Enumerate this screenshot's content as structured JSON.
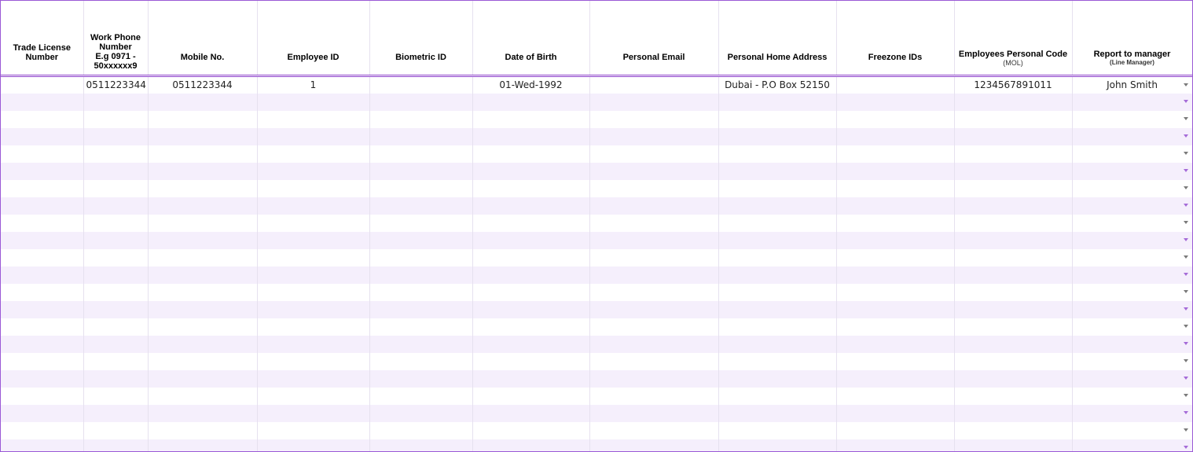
{
  "headers": {
    "trade_license": "Trade License Number",
    "work_phone_line1": "Work Phone Number",
    "work_phone_line2": "E.g 0971 - 50xxxxxx9",
    "mobile": "Mobile No.",
    "employee_id": "Employee ID",
    "biometric_id": "Biometric ID",
    "dob": "Date of Birth",
    "personal_email": "Personal Email",
    "home_address": "Personal Home Address",
    "freezone_ids": "Freezone IDs",
    "personal_code": "Employees Personal Code",
    "personal_code_sub": "(MOL)",
    "report_to": "Report to manager",
    "report_to_sub": "(Line Manager)"
  },
  "row1": {
    "trade_license": "",
    "work_phone": "0511223344",
    "mobile": "0511223344",
    "employee_id": "1",
    "biometric_id": "",
    "dob": "01-Wed-1992",
    "personal_email": "",
    "home_address": "Dubai - P.O Box 52150",
    "freezone_ids": "",
    "personal_code": "1234567891011",
    "report_to": "John Smith"
  },
  "colors": {
    "accent": "#9b59d6",
    "row_alt": "#f5effc",
    "grid": "#e6e1ef"
  }
}
